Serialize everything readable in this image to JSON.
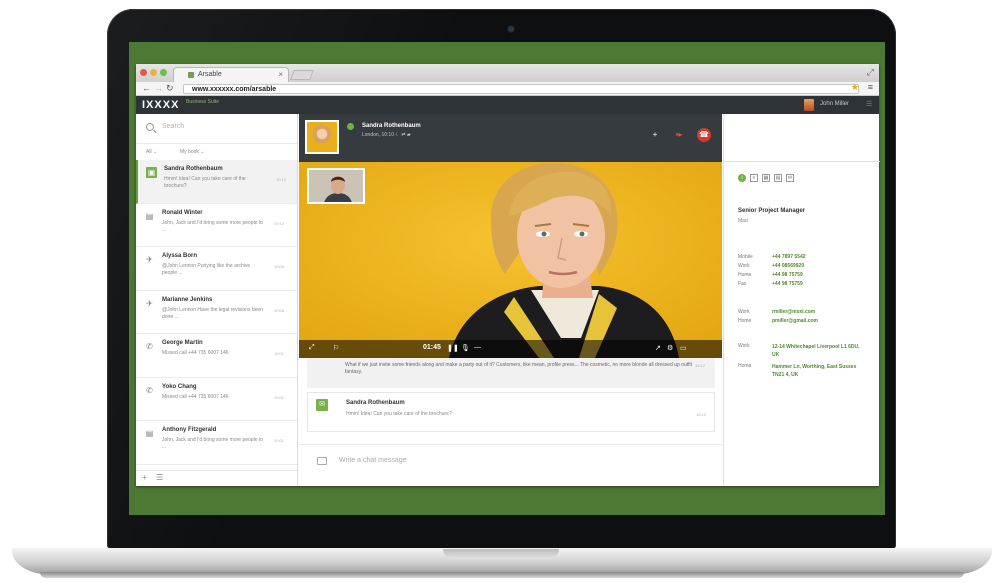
{
  "browser": {
    "tab_title": "Arsable",
    "url": "www.xxxxxx.com/arsable"
  },
  "app": {
    "logo": "IXXXX",
    "logo_sub": "Business Suite",
    "user_name": "John Miller"
  },
  "sidebar": {
    "search_placeholder": "Search",
    "filters": {
      "all": "All  ⌄",
      "mine": "My book  ⌄"
    },
    "items": [
      {
        "name": "Sandra Rothenbaum",
        "text": "Hmm! Idea! Can you take care of the brochure?",
        "time": "10:12",
        "icon": "▣",
        "active": true
      },
      {
        "name": "Ronald Winter",
        "text": "John, Jack and I'd bring some more people to ...",
        "time": "10:12",
        "icon": "▤",
        "active": false
      },
      {
        "name": "Alyssa Born",
        "text": "@John Lennon Purlying like the archive people ...",
        "time": "10:08",
        "icon": "✈",
        "active": false
      },
      {
        "name": "Marianne Jenkins",
        "text": "@John Lennon Have the legal revisions been done ...",
        "time": "10:08",
        "icon": "✈",
        "active": false
      },
      {
        "name": "George Martin",
        "text": "Missed call +44 735 6007 146",
        "time": "10:01",
        "icon": "✆",
        "active": false
      },
      {
        "name": "Yoko Chang",
        "text": "Missed call +44 735 6007 146",
        "time": "10:01",
        "icon": "✆",
        "active": false
      },
      {
        "name": "Anthony Fitzgerald",
        "text": "John, Jack and I'd bring some more people to ...",
        "time": "10:01",
        "icon": "▤",
        "active": false
      }
    ],
    "footer_add": "+",
    "footer_menu": "☰"
  },
  "call": {
    "caller_name": "Sandra Rothenbaum",
    "caller_location": "London, 10:10  ☾   ⇄  ▰",
    "time": "01:45",
    "chat_history": "What if we just invite some friends along and make a party out of it? Customers, like mean, profile press... The cosmetic, no more blonde all dressed up outfit fantasy.",
    "chat_time": "10:12",
    "last_msg_name": "Sandra Rothenbaum",
    "last_msg_text": "Hmm! Idea! Can you take care of the brochure?",
    "last_msg_time": "10:12",
    "input_placeholder": "Write a chat message"
  },
  "contact": {
    "role": "Senior Project Manager",
    "role_sub": "Mad",
    "fields": [
      {
        "label": "Mobile",
        "value": "+44 7897 5542"
      },
      {
        "label": "Work",
        "value": "+44 08569920"
      },
      {
        "label": "Home",
        "value": "+44 98 75759"
      },
      {
        "label": "Fax",
        "value": "+44 98 75759"
      },
      {
        "label": "Work",
        "value": "rmiller@mxxi.com"
      },
      {
        "label": "Home",
        "value": "pmiller@gmail.com"
      },
      {
        "label": "Work",
        "value": "12-14 Whitechapel Liverpool L1 6DU, UK"
      },
      {
        "label": "Home",
        "value": "Hammer Ln, Worthing, East Sussex TN21 4, UK"
      }
    ]
  },
  "colors": {
    "accent": "#6fb43f",
    "screen_bg": "#4c7a34",
    "appbar": "#2e3338",
    "hangup": "#d03a2f",
    "video_bg": "#f1b51c"
  }
}
